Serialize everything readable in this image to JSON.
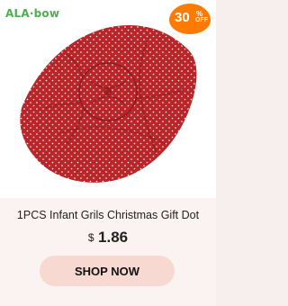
{
  "brand": {
    "logo_text": "ALA·bow"
  },
  "badge": {
    "number": "30",
    "percent": "%",
    "off": "OFF",
    "color": "#ff7a00"
  },
  "product": {
    "image_icon": "knotted-headband-image",
    "title": "1PCS Infant Grils Christmas Gift Dot",
    "currency": "$",
    "price": "1.86"
  },
  "actions": {
    "shop_label": "SHOP NOW"
  }
}
